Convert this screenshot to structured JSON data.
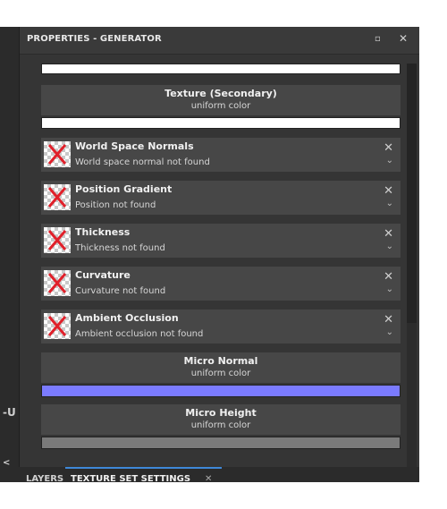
{
  "left_strip": {
    "shortcut_glyph": "-U",
    "small_glyph": "<"
  },
  "panel": {
    "title": "PROPERTIES - GENERATOR",
    "float_icon": "float-window-icon",
    "close_icon": "close-icon",
    "top_swatch_color": "#ffffff",
    "texture_secondary": {
      "title": "Texture (Secondary)",
      "subtitle": "uniform color",
      "swatch_color": "#ffffff"
    },
    "slots": [
      {
        "title": "World Space Normals",
        "subtitle": "World space normal not found"
      },
      {
        "title": "Position Gradient",
        "subtitle": "Position not found"
      },
      {
        "title": "Thickness",
        "subtitle": "Thickness not found"
      },
      {
        "title": "Curvature",
        "subtitle": "Curvature not found"
      },
      {
        "title": "Ambient Occlusion",
        "subtitle": "Ambient occlusion not found"
      }
    ],
    "micro_normal": {
      "title": "Micro Normal",
      "subtitle": "uniform color",
      "swatch_color": "#7b7bff"
    },
    "micro_height": {
      "title": "Micro Height",
      "subtitle": "uniform color",
      "swatch_color": "#7a7a7a"
    },
    "slot_close_glyph": "✕",
    "slot_expand_glyph": "⌄"
  },
  "bottom_tabs": {
    "tab1": "LAYERS",
    "tab2": "TEXTURE SET SETTINGS",
    "tab2_close": "✕"
  },
  "colors": {
    "panel_bg": "#353535",
    "card_bg": "#474747",
    "accent": "#3e88d8",
    "missing_x": "#e0202a"
  }
}
